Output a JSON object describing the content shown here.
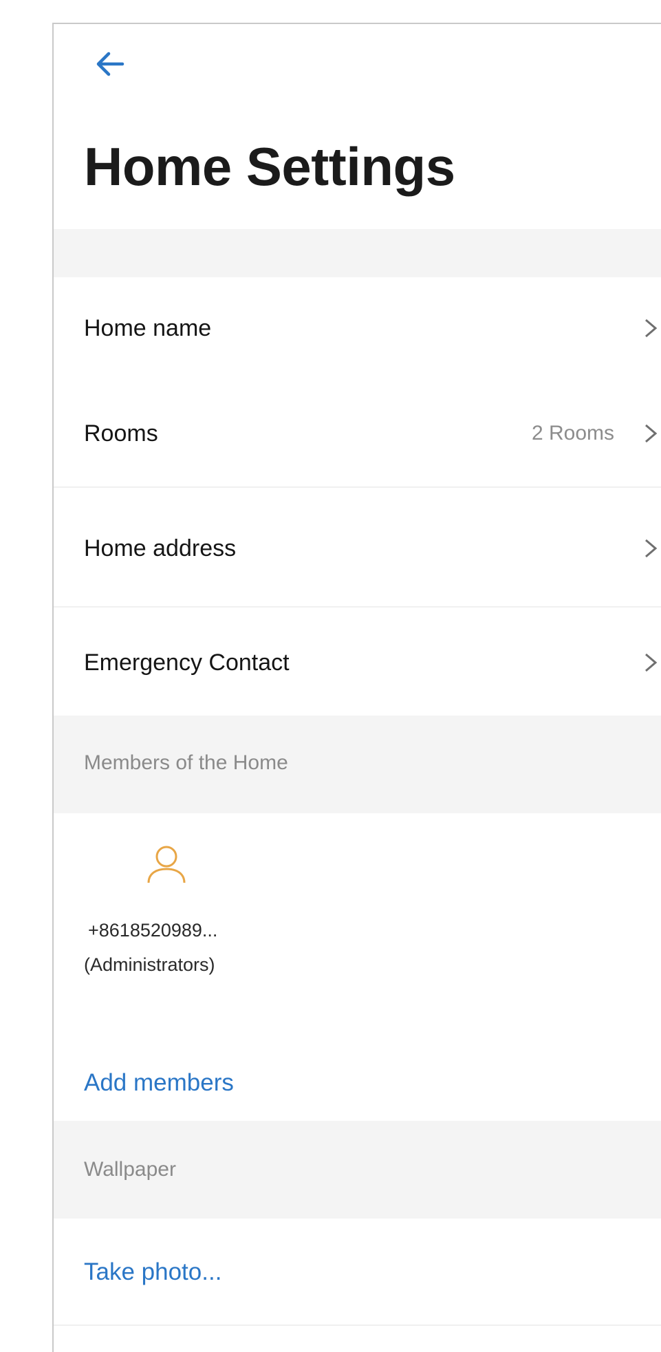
{
  "header": {
    "back_icon": "arrow-left-icon",
    "title": "Home Settings"
  },
  "settings": {
    "items": [
      {
        "label": "Home name",
        "value": ""
      },
      {
        "label": "Rooms",
        "value": "2 Rooms"
      },
      {
        "label": "Home address",
        "value": ""
      },
      {
        "label": "Emergency Contact",
        "value": ""
      }
    ]
  },
  "members": {
    "section_title": "Members of the Home",
    "list": [
      {
        "phone": "+8618520989...",
        "role": "(Administrators)",
        "avatar_icon": "person-icon"
      }
    ],
    "add_label": "Add members"
  },
  "wallpaper": {
    "section_title": "Wallpaper",
    "take_photo_label": "Take photo..."
  },
  "colors": {
    "accent": "#2a76c6",
    "avatar": "#e8a646",
    "background_gap": "#f4f4f4",
    "text_primary": "#151515",
    "text_secondary": "#8c8c8c"
  }
}
